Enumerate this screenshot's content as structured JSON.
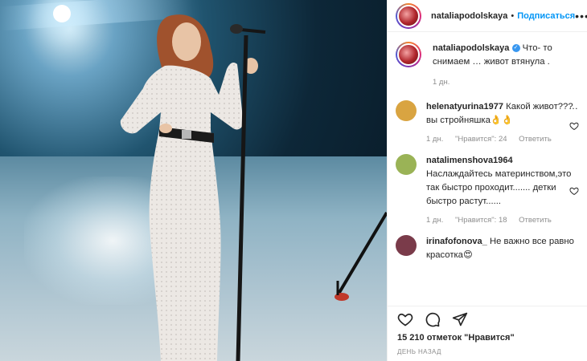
{
  "header": {
    "username": "nataliapodolskaya",
    "separator": "•",
    "follow_label": "Подписаться",
    "more_icon": "more-horizontal-icon"
  },
  "caption": {
    "username": "nataliapodolskaya",
    "verified_icon": "check-icon",
    "text": "Что- то снимаем … живот втянула .",
    "time": "1 дн."
  },
  "comments": [
    {
      "username": "helenatyurina1977",
      "text": "Какой живот???вы стройняшка👌👌",
      "time": "1 дн.",
      "likes": "\"Нравится\": 24",
      "reply": "Ответить",
      "avatar_color": "#d9a441"
    },
    {
      "username": "natalimenshova1964",
      "text": "Наслаждайтесь материнством,это так быстро проходит....... детки быстро растут......",
      "time": "1 дн.",
      "likes": "\"Нравится\": 18",
      "reply": "Ответить",
      "avatar_color": "#9ab356"
    },
    {
      "username": "irinafofonova_",
      "text": "Не важно все равно красотка😍",
      "time": "",
      "likes": "",
      "reply": "",
      "avatar_color": "#7a3b4a"
    }
  ],
  "actions": {
    "like_icon": "heart-icon",
    "comment_icon": "comment-icon",
    "share_icon": "paper-plane-icon"
  },
  "likes_summary": "15 210 отметок \"Нравится\"",
  "post_date": "ДЕНЬ НАЗАД",
  "colors": {
    "accent": "#0095f6",
    "verified": "#3897f0",
    "muted": "#8e8e8e"
  }
}
